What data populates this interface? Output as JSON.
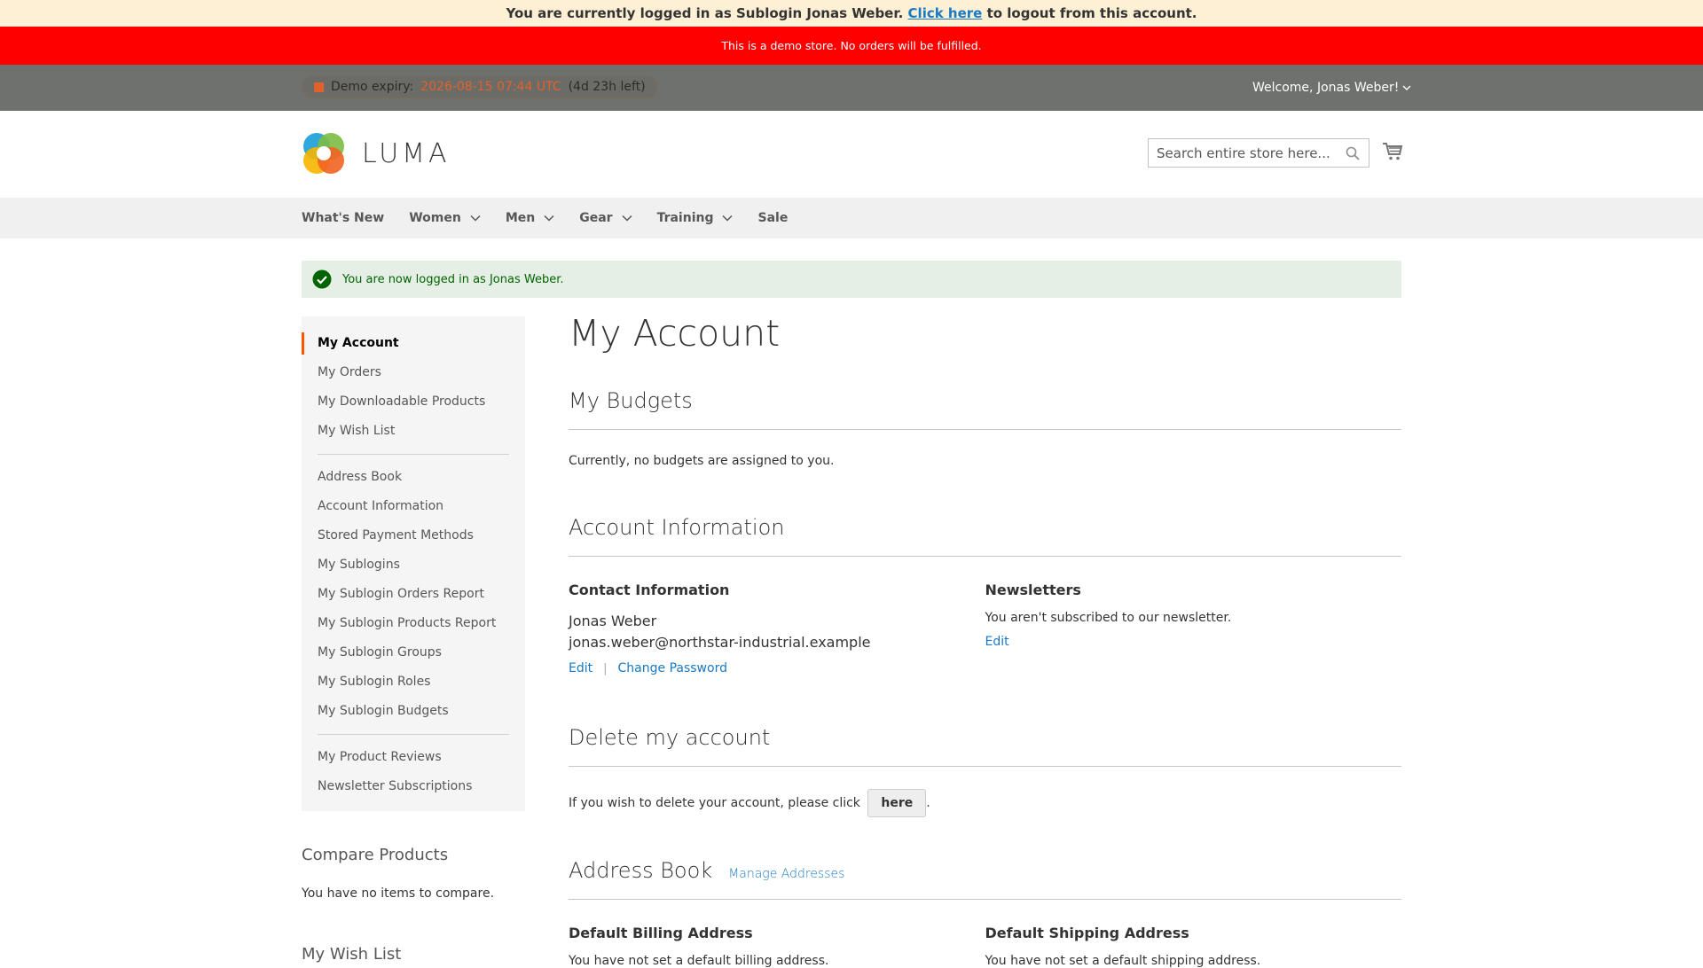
{
  "sublogin_bar": {
    "prefix": "You are currently logged in as Sublogin Jonas Weber.",
    "link": "Click here",
    "suffix": "to logout from this account."
  },
  "demo_notice": "This is a demo store. No orders will be fulfilled.",
  "panel": {
    "expiry_label": "Demo expiry:",
    "expiry_date": "2026-08-15 07:44 UTC",
    "expiry_left": "(4d 23h left)",
    "welcome": "Welcome, Jonas Weber!"
  },
  "header": {
    "logo_text": "LUMA",
    "search_placeholder": "Search entire store here..."
  },
  "nav": [
    "What's New",
    "Women",
    "Men",
    "Gear",
    "Training",
    "Sale"
  ],
  "message": "You are now logged in as Jonas Weber.",
  "sidebar": {
    "group1": [
      "My Account",
      "My Orders",
      "My Downloadable Products",
      "My Wish List"
    ],
    "group2": [
      "Address Book",
      "Account Information",
      "Stored Payment Methods",
      "My Sublogins",
      "My Sublogin Orders Report",
      "My Sublogin Products Report",
      "My Sublogin Groups",
      "My Sublogin Roles",
      "My Sublogin Budgets"
    ],
    "group3": [
      "My Product Reviews",
      "Newsletter Subscriptions"
    ]
  },
  "compare": {
    "title": "Compare Products",
    "text": "You have no items to compare."
  },
  "wishlist_title": "My Wish List",
  "main": {
    "page_title": "My Account",
    "budgets_title": "My Budgets",
    "budgets_text": "Currently, no budgets are assigned to you.",
    "account_info_title": "Account Information",
    "contact_title": "Contact Information",
    "contact_name": "Jonas Weber",
    "contact_email": "jonas.weber@northstar-industrial.example",
    "edit": "Edit",
    "change_password": "Change Password",
    "newsletters_title": "Newsletters",
    "newsletters_text": "You aren't subscribed to our newsletter.",
    "delete_title": "Delete my account",
    "delete_text": "If you wish to delete your account, please click",
    "delete_button": "here",
    "address_title": "Address Book",
    "manage_addresses": "Manage Addresses",
    "billing_title": "Default Billing Address",
    "billing_text": "You have not set a default billing address.",
    "shipping_title": "Default Shipping Address",
    "shipping_text": "You have not set a default shipping address."
  },
  "colors": {
    "accent": "#ff5501",
    "link": "#1979c3",
    "notice_red": "#ff0000",
    "panel_gray": "#6e716e"
  }
}
